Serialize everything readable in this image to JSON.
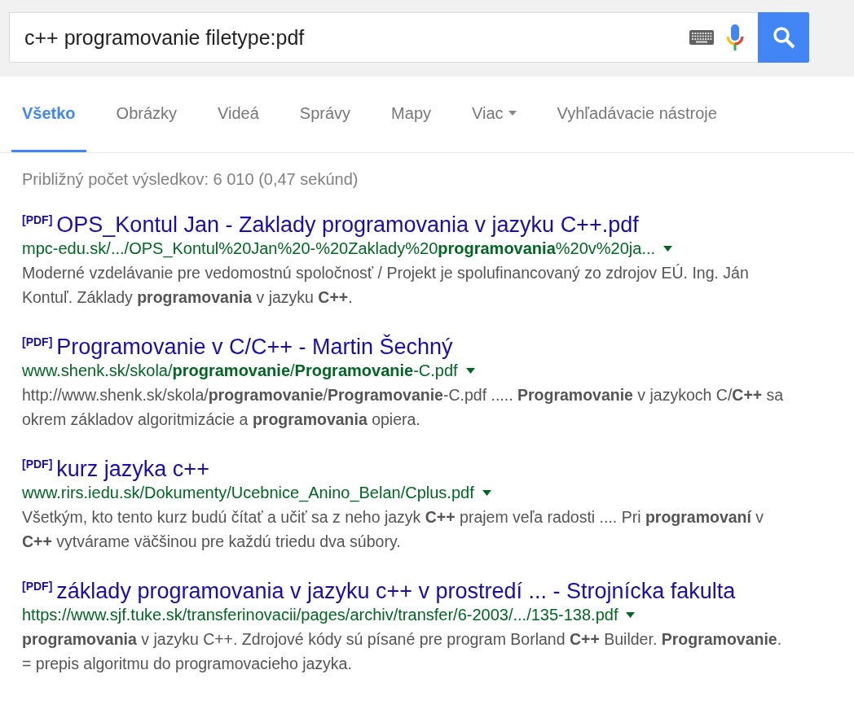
{
  "search": {
    "value": "c++ programovanie filetype:pdf"
  },
  "tabs": [
    {
      "label": "Všetko",
      "selected": true,
      "dropdown": false
    },
    {
      "label": "Obrázky",
      "selected": false,
      "dropdown": false
    },
    {
      "label": "Videá",
      "selected": false,
      "dropdown": false
    },
    {
      "label": "Správy",
      "selected": false,
      "dropdown": false
    },
    {
      "label": "Mapy",
      "selected": false,
      "dropdown": false
    },
    {
      "label": "Viac",
      "selected": false,
      "dropdown": true
    },
    {
      "label": "Vyhľadávacie nástroje",
      "selected": false,
      "dropdown": false
    }
  ],
  "result_stats": "Približný počet výsledkov: 6 010 (0,47 sekúnd)",
  "results": [
    {
      "tag": "[PDF]",
      "title": "OPS_Kontul Jan - Zaklady programovania v jazyku C++.pdf",
      "url": "mpc-edu.sk/.../OPS_Kontul%20Jan%20-%20Zaklady%20**programovania**%20v%20ja...",
      "snippet": "Moderné vzdelávanie pre vedomostnú spoločnosť / Projekt je spolufinancovaný zo zdrojov EÚ. Ing. Ján Kontuľ. Základy **programovania** v jazyku **C++**."
    },
    {
      "tag": "[PDF]",
      "title": "Programovanie v C/C++ - Martin Šechný",
      "url": "www.shenk.sk/skola/**programovanie**/**Programovanie**-C.pdf",
      "snippet": "http://www.shenk.sk/skola/**programovanie**/**Programovanie**-C.pdf ..... **Programovanie** v jazykoch C/**C++** sa okrem základov algoritmizácie a **programovania** opiera."
    },
    {
      "tag": "[PDF]",
      "title": "kurz jazyka c++",
      "url": "www.rirs.iedu.sk/Dokumenty/Ucebnice_Anino_Belan/Cplus.pdf",
      "snippet": "Všetkým, kto tento kurz budú čítať a učiť sa z neho jazyk **C++** prajem veľa radosti .... Pri **programovaní** v **C++** vytvárame väčšinou pre každú triedu dva súbory."
    },
    {
      "tag": "[PDF]",
      "title": "základy programovania v jazyku c++ v prostredí ... - Strojnícka fakulta",
      "url": "https://www.sjf.tuke.sk/transferinovacii/pages/archiv/transfer/6-2003/.../135-138.pdf",
      "snippet": "**programovania** v jazyku C++. Zdrojové kódy sú písané pre program Borland **C++** Builder. **Programovanie**. = prepis algoritmu do programovacieho jazyka."
    }
  ]
}
